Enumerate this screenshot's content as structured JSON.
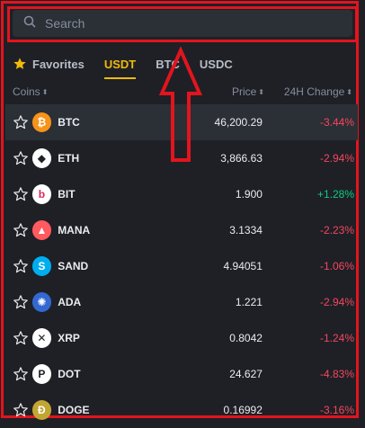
{
  "search": {
    "placeholder": "Search"
  },
  "tabs": [
    {
      "label": "Favorites",
      "icon": "star-filled-icon",
      "active": false
    },
    {
      "label": "USDT",
      "active": true
    },
    {
      "label": "BTC",
      "active": false
    },
    {
      "label": "USDC",
      "active": false
    }
  ],
  "columns": {
    "coins": "Coins",
    "price": "Price",
    "change": "24H Change"
  },
  "rows": [
    {
      "symbol": "BTC",
      "price": "46,200.29",
      "change": "-3.44%",
      "direction": "down",
      "icon": "btc-icon",
      "icon_bg": "#f7931a",
      "glyph": "₿"
    },
    {
      "symbol": "ETH",
      "price": "3,866.63",
      "change": "-2.94%",
      "direction": "down",
      "icon": "eth-icon",
      "icon_bg": "#ffffff",
      "glyph": "◆"
    },
    {
      "symbol": "BIT",
      "price": "1.900",
      "change": "+1.28%",
      "direction": "up",
      "icon": "bit-icon",
      "icon_bg": "#ffffff",
      "glyph": "b"
    },
    {
      "symbol": "MANA",
      "price": "3.1334",
      "change": "-2.23%",
      "direction": "down",
      "icon": "mana-icon",
      "icon_bg": "#ff5a5f",
      "glyph": "▲"
    },
    {
      "symbol": "SAND",
      "price": "4.94051",
      "change": "-1.06%",
      "direction": "down",
      "icon": "sand-icon",
      "icon_bg": "#00adef",
      "glyph": "S"
    },
    {
      "symbol": "ADA",
      "price": "1.221",
      "change": "-2.94%",
      "direction": "down",
      "icon": "ada-icon",
      "icon_bg": "#3468d1",
      "glyph": "✺"
    },
    {
      "symbol": "XRP",
      "price": "0.8042",
      "change": "-1.24%",
      "direction": "down",
      "icon": "xrp-icon",
      "icon_bg": "#ffffff",
      "glyph": "✕"
    },
    {
      "symbol": "DOT",
      "price": "24.627",
      "change": "-4.83%",
      "direction": "down",
      "icon": "dot-icon",
      "icon_bg": "#ffffff",
      "glyph": "P"
    },
    {
      "symbol": "DOGE",
      "price": "0.16992",
      "change": "-3.16%",
      "direction": "down",
      "icon": "doge-icon",
      "icon_bg": "#c2a633",
      "glyph": "Ð"
    }
  ],
  "colors": {
    "accent": "#f0b90b",
    "negative": "#f6465d",
    "positive": "#0ecb81",
    "highlight": "#e3141e"
  }
}
